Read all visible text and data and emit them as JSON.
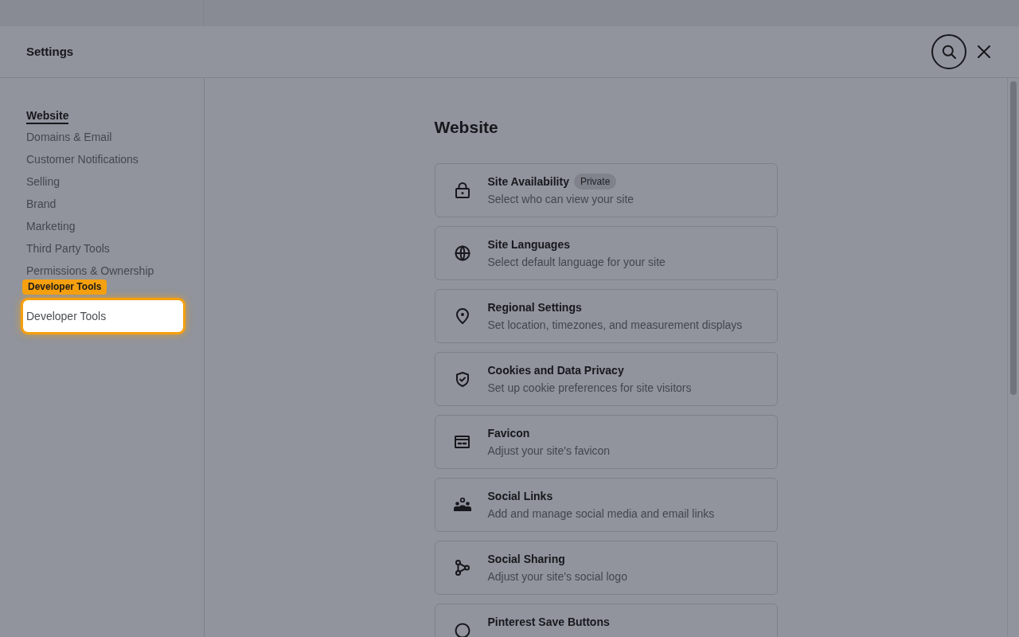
{
  "header": {
    "title": "Settings"
  },
  "sidebar": {
    "items": [
      {
        "label": "Website",
        "selected": true,
        "highlighted": false
      },
      {
        "label": "Domains & Email",
        "selected": false,
        "highlighted": false
      },
      {
        "label": "Customer Notifications",
        "selected": false,
        "highlighted": false
      },
      {
        "label": "Selling",
        "selected": false,
        "highlighted": false
      },
      {
        "label": "Brand",
        "selected": false,
        "highlighted": false
      },
      {
        "label": "Marketing",
        "selected": false,
        "highlighted": false
      },
      {
        "label": "Third Party Tools",
        "selected": false,
        "highlighted": false
      },
      {
        "label": "Permissions & Ownership",
        "selected": false,
        "highlighted": false
      },
      {
        "label": "Developer Tools",
        "selected": false,
        "highlighted": true
      }
    ]
  },
  "callout": {
    "label": "Developer Tools"
  },
  "main": {
    "heading": "Website",
    "cards": [
      {
        "title": "Site Availability",
        "badge": "Private",
        "description": "Select who can view your site"
      },
      {
        "title": "Site Languages",
        "description": "Select default language for your site"
      },
      {
        "title": "Regional Settings",
        "description": "Set location, timezones, and measurement displays"
      },
      {
        "title": "Cookies and Data Privacy",
        "description": "Set up cookie preferences for site visitors"
      },
      {
        "title": "Favicon",
        "description": "Adjust your site's favicon"
      },
      {
        "title": "Social Links",
        "description": "Add and manage social media and email links"
      },
      {
        "title": "Social Sharing",
        "description": "Adjust your site's social logo"
      },
      {
        "title": "Pinterest Save Buttons"
      }
    ]
  }
}
